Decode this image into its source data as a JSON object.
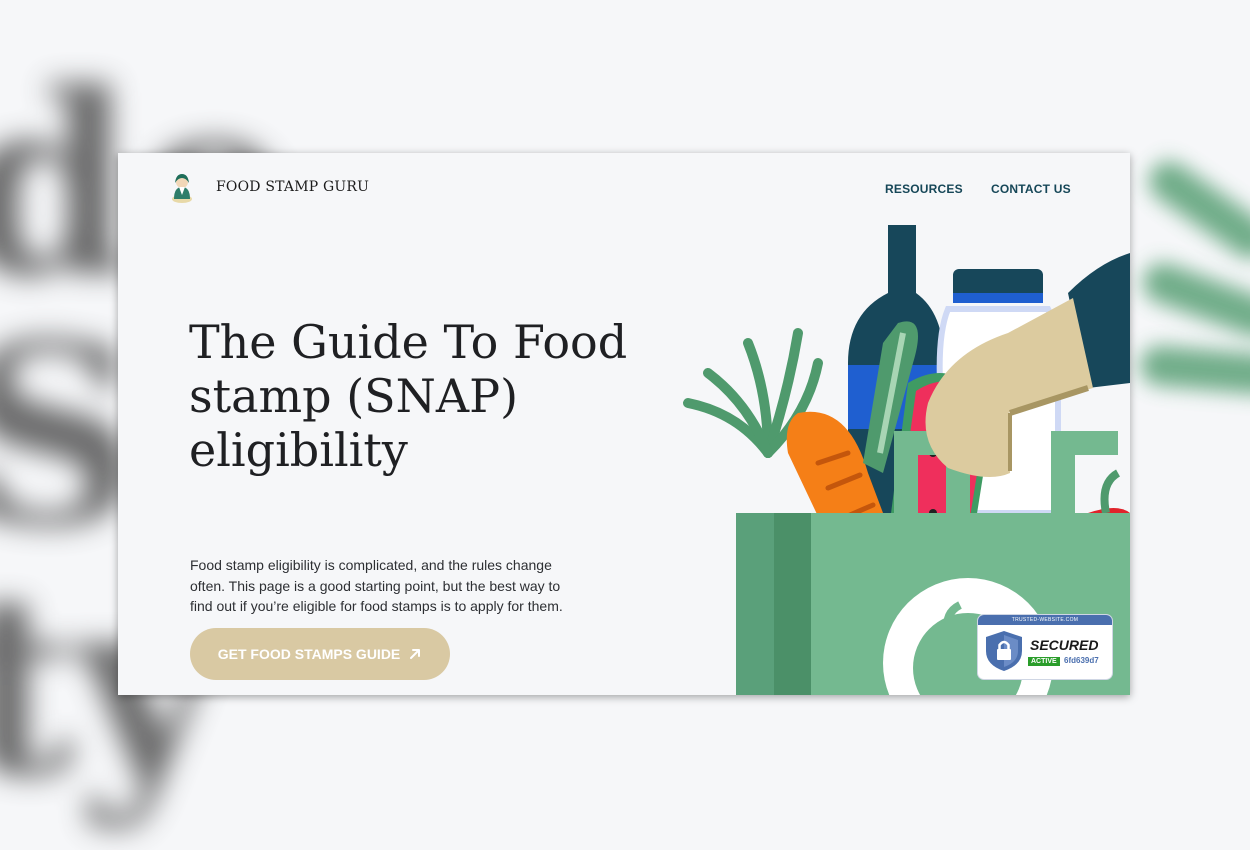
{
  "header": {
    "brand": "FOOD STAMP GURU",
    "nav": {
      "resources": "RESOURCES",
      "contact": "CONTACT US"
    }
  },
  "hero": {
    "title": "The Guide To Food stamp (SNAP) eligibility",
    "description": "Food stamp eligibility is complicated, and the rules change often. This page is a good starting point, but the best way to find out if you’re eligible for food stamps is to apply for them.",
    "cta_label": "GET FOOD STAMPS GUIDE"
  },
  "badge": {
    "top_text": "TRUSTED-WEBSITE.COM",
    "secured": "SECURED",
    "status": "ACTIVE",
    "code": "6fd639d7"
  },
  "colors": {
    "nav_link": "#164758",
    "cta_bg": "#d9c9a3",
    "bag_green": "#74b990",
    "bag_dark_green": "#4b9068",
    "bottle_navy": "#17475a",
    "watermelon": "#ef2f5c",
    "carrot": "#f57f17",
    "hand": "#dccb9f",
    "sleeve": "#17475a"
  },
  "icons": {
    "logo": "guru-portrait-logo",
    "cta_arrow": "arrow-up-right-icon",
    "badge_shield": "shield-lock-icon"
  }
}
